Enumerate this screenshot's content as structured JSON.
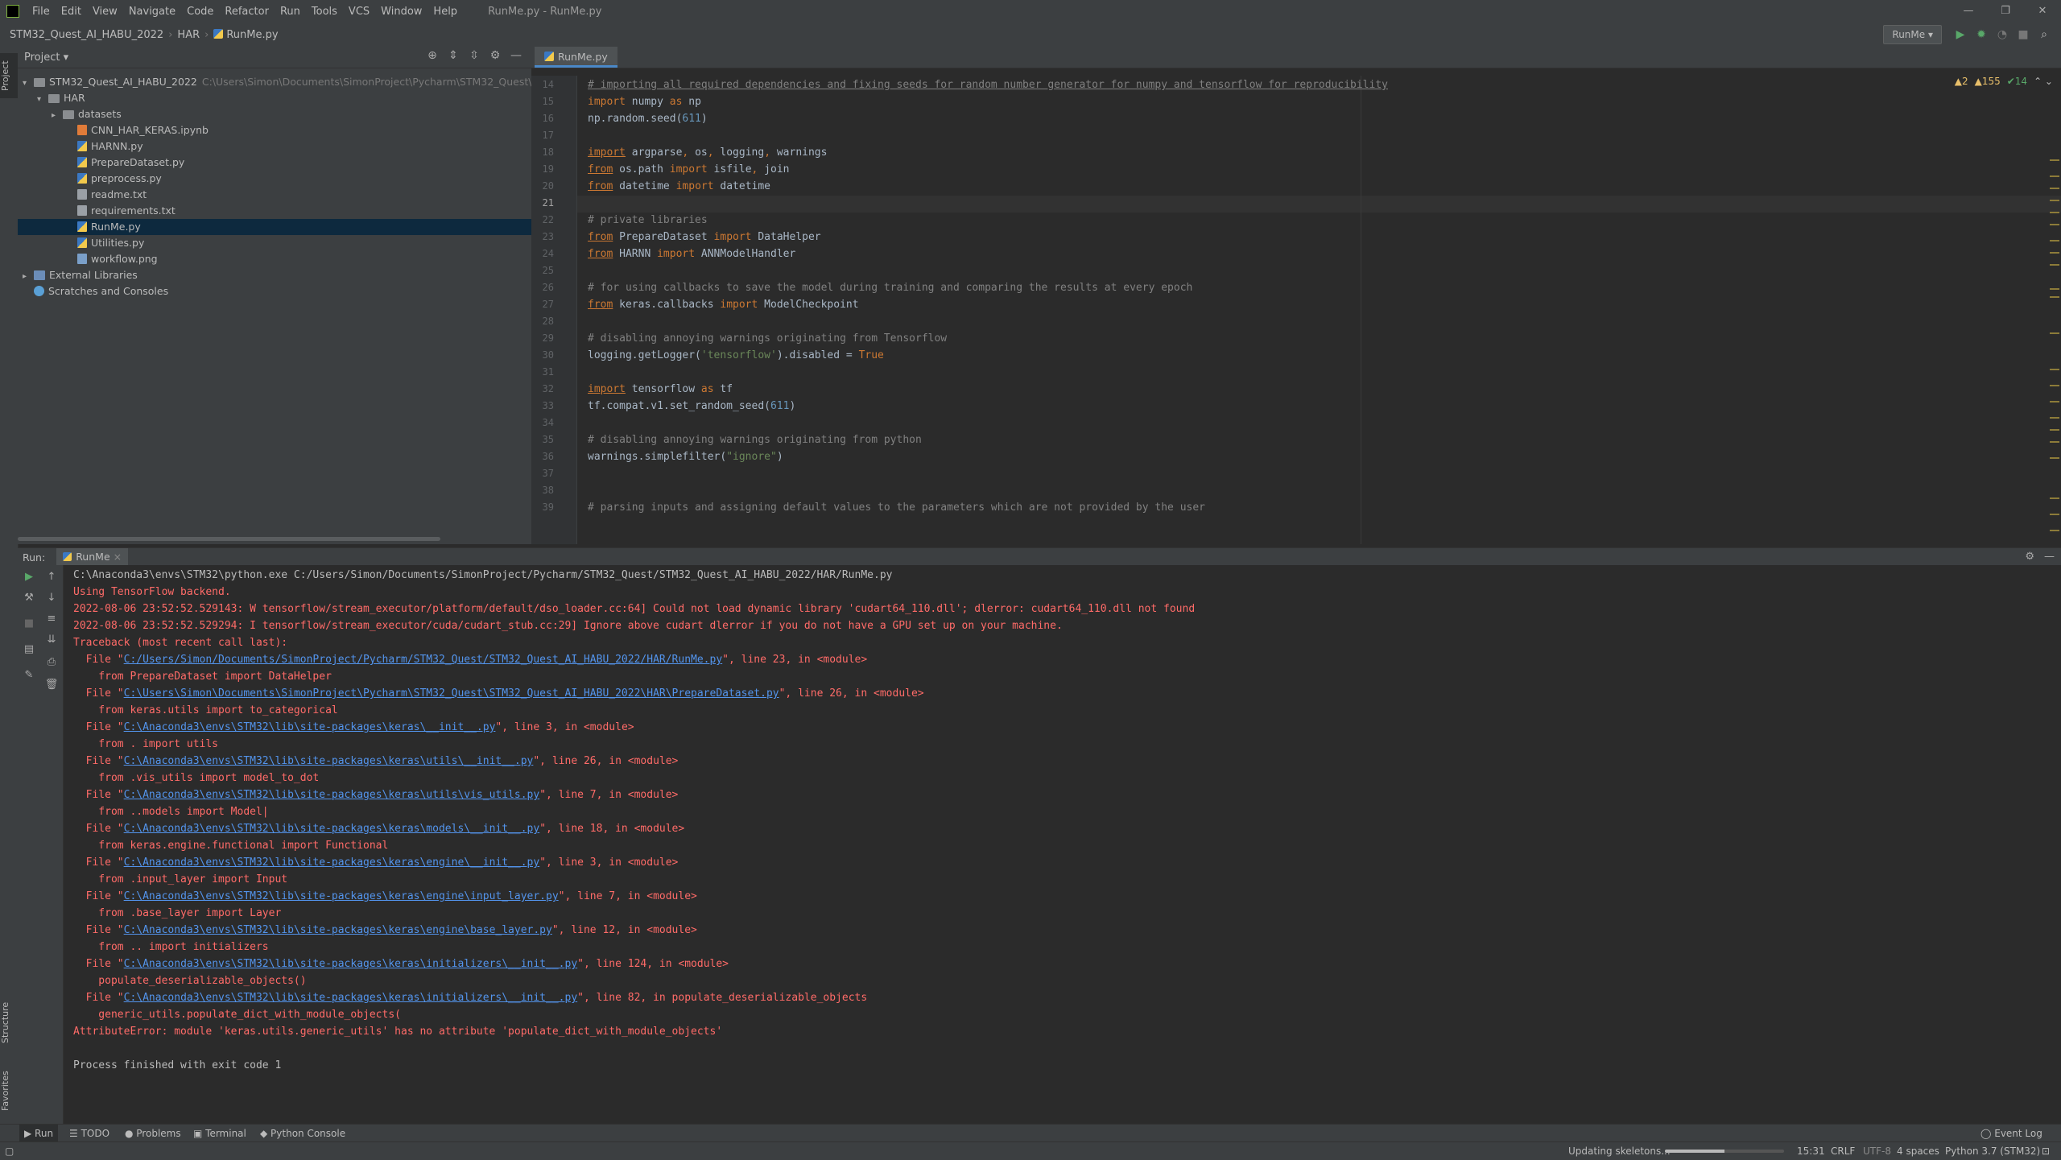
{
  "menubar": {
    "items": [
      "File",
      "Edit",
      "View",
      "Navigate",
      "Code",
      "Refactor",
      "Run",
      "Tools",
      "VCS",
      "Window",
      "Help"
    ],
    "window_title": "RunMe.py - RunMe.py",
    "controls": [
      "—",
      "❐",
      "✕"
    ]
  },
  "navbar": {
    "crumbs": [
      "STM32_Quest_AI_HABU_2022",
      "HAR",
      "RunMe.py"
    ],
    "run_config": "RunMe ▾"
  },
  "left_stripe": {
    "project": "Project",
    "structure": "Structure",
    "favorites": "Favorites"
  },
  "project_panel": {
    "title": "Project ▾",
    "tree": [
      {
        "label": "STM32_Quest_AI_HABU_2022",
        "path": "C:\\Users\\Simon\\Documents\\SimonProject\\Pycharm\\STM32_Quest\\STM3",
        "icon": "folder",
        "arrow": "▾",
        "indent": 0
      },
      {
        "label": "HAR",
        "icon": "folder",
        "arrow": "▾",
        "indent": 1
      },
      {
        "label": "datasets",
        "icon": "folder",
        "arrow": "▸",
        "indent": 2
      },
      {
        "label": "CNN_HAR_KERAS.ipynb",
        "icon": "nb",
        "arrow": "",
        "indent": 3
      },
      {
        "label": "HARNN.py",
        "icon": "py",
        "arrow": "",
        "indent": 3
      },
      {
        "label": "PrepareDataset.py",
        "icon": "py",
        "arrow": "",
        "indent": 3
      },
      {
        "label": "preprocess.py",
        "icon": "py",
        "arrow": "",
        "indent": 3
      },
      {
        "label": "readme.txt",
        "icon": "txt",
        "arrow": "",
        "indent": 3
      },
      {
        "label": "requirements.txt",
        "icon": "txt",
        "arrow": "",
        "indent": 3
      },
      {
        "label": "RunMe.py",
        "icon": "py",
        "arrow": "",
        "indent": 3,
        "selected": true
      },
      {
        "label": "Utilities.py",
        "icon": "py",
        "arrow": "",
        "indent": 3
      },
      {
        "label": "workflow.png",
        "icon": "img",
        "arrow": "",
        "indent": 3
      },
      {
        "label": "External Libraries",
        "icon": "lib",
        "arrow": "▸",
        "indent": 0
      },
      {
        "label": "Scratches and Consoles",
        "icon": "scr",
        "arrow": "",
        "indent": 0
      }
    ]
  },
  "editor": {
    "tab": "RunMe.py",
    "inspections": {
      "warn1": "▲2",
      "warn2": "▲155",
      "ok": "✔14",
      "nav": "⌃ ⌄"
    },
    "current_line": 21,
    "lines": [
      {
        "n": 14,
        "html": "<span class=\"cm ul\"># importing all required dependencies and fixing seeds for random number generator for numpy and tensorflow for reproducibility</span>"
      },
      {
        "n": 15,
        "html": "<span class=\"kw\">import</span> numpy <span class=\"kw\">as</span> np"
      },
      {
        "n": 16,
        "html": "np.random.seed(<span class=\"num\">611</span>)"
      },
      {
        "n": 17,
        "html": ""
      },
      {
        "n": 18,
        "html": "<span class=\"kw ul\">import</span> argparse<span class=\"kw\">,</span> os<span class=\"kw\">,</span> logging<span class=\"kw\">,</span> warnings"
      },
      {
        "n": 19,
        "html": "<span class=\"kw ul\">from</span> os.path <span class=\"kw\">import</span> isfile<span class=\"kw\">,</span> join"
      },
      {
        "n": 20,
        "html": "<span class=\"kw ul\">from</span> datetime <span class=\"kw\">import</span> datetime"
      },
      {
        "n": 21,
        "html": ""
      },
      {
        "n": 22,
        "html": "<span class=\"cm\"># private libraries</span>"
      },
      {
        "n": 23,
        "html": "<span class=\"kw ul\">from</span> PrepareDataset <span class=\"kw\">import</span> DataHelper"
      },
      {
        "n": 24,
        "html": "<span class=\"kw ul\">from</span> HARNN <span class=\"kw\">import</span> ANNModelHandler"
      },
      {
        "n": 25,
        "html": ""
      },
      {
        "n": 26,
        "html": "<span class=\"cm\"># for using callbacks to save the model during training and comparing the results at every epoch</span>"
      },
      {
        "n": 27,
        "html": "<span class=\"kw ul\">from</span> keras.callbacks <span class=\"kw\">import</span> ModelCheckpoint"
      },
      {
        "n": 28,
        "html": ""
      },
      {
        "n": 29,
        "html": "<span class=\"cm\"># disabling annoying warnings originating from Tensorflow</span>"
      },
      {
        "n": 30,
        "html": "logging.getLogger(<span class=\"str\">'tensorflow'</span>).disabled = <span class=\"kw\">True</span>"
      },
      {
        "n": 31,
        "html": ""
      },
      {
        "n": 32,
        "html": "<span class=\"kw ul\">import</span> tensorflow <span class=\"kw\">as</span> tf"
      },
      {
        "n": 33,
        "html": "tf.compat.v1.set_random_seed(<span class=\"num\">611</span>)"
      },
      {
        "n": 34,
        "html": ""
      },
      {
        "n": 35,
        "html": "<span class=\"cm\"># disabling annoying warnings originating from python</span>"
      },
      {
        "n": 36,
        "html": "warnings.simplefilter(<span class=\"str\">\"ignore\"</span>)"
      },
      {
        "n": 37,
        "html": ""
      },
      {
        "n": 38,
        "html": ""
      },
      {
        "n": 39,
        "html": "<span class=\"cm\"># parsing inputs and assigning default values to the parameters which are not provided by the user</span>"
      }
    ]
  },
  "run_panel": {
    "label": "Run:",
    "tab": "RunMe",
    "lines": [
      {
        "c": "cw",
        "html": "C:\\Anaconda3\\envs\\STM32\\python.exe C:/Users/Simon/Documents/SimonProject/Pycharm/STM32_Quest/STM32_Quest_AI_HABU_2022/HAR/RunMe.py"
      },
      {
        "c": "cr",
        "html": "Using TensorFlow backend."
      },
      {
        "c": "cr",
        "html": "2022-08-06 23:52:52.529143: W tensorflow/stream_executor/platform/default/dso_loader.cc:64] Could not load dynamic library 'cudart64_110.dll'; dlerror: cudart64_110.dll not found"
      },
      {
        "c": "cr",
        "html": "2022-08-06 23:52:52.529294: I tensorflow/stream_executor/cuda/cudart_stub.cc:29] Ignore above cudart dlerror if you do not have a GPU set up on your machine."
      },
      {
        "c": "cr",
        "html": "Traceback (most recent call last):"
      },
      {
        "c": "cr",
        "html": "  File \"<span class=\"clink\">C:/Users/Simon/Documents/SimonProject/Pycharm/STM32_Quest/STM32_Quest_AI_HABU_2022/HAR/RunMe.py</span>\", line 23, in &lt;module&gt;"
      },
      {
        "c": "cr",
        "html": "    from PrepareDataset import DataHelper"
      },
      {
        "c": "cr",
        "html": "  File \"<span class=\"clink\">C:\\Users\\Simon\\Documents\\SimonProject\\Pycharm\\STM32_Quest\\STM32_Quest_AI_HABU_2022\\HAR\\PrepareDataset.py</span>\", line 26, in &lt;module&gt;"
      },
      {
        "c": "cr",
        "html": "    from keras.utils import to_categorical"
      },
      {
        "c": "cr",
        "html": "  File \"<span class=\"clink\">C:\\Anaconda3\\envs\\STM32\\lib\\site-packages\\keras\\__init__.py</span>\", line 3, in &lt;module&gt;"
      },
      {
        "c": "cr",
        "html": "    from . import utils"
      },
      {
        "c": "cr",
        "html": "  File \"<span class=\"clink\">C:\\Anaconda3\\envs\\STM32\\lib\\site-packages\\keras\\utils\\__init__.py</span>\", line 26, in &lt;module&gt;"
      },
      {
        "c": "cr",
        "html": "    from .vis_utils import model_to_dot"
      },
      {
        "c": "cr",
        "html": "  File \"<span class=\"clink\">C:\\Anaconda3\\envs\\STM32\\lib\\site-packages\\keras\\utils\\vis_utils.py</span>\", line 7, in &lt;module&gt;"
      },
      {
        "c": "cr",
        "html": "    from ..models import Model|"
      },
      {
        "c": "cr",
        "html": "  File \"<span class=\"clink\">C:\\Anaconda3\\envs\\STM32\\lib\\site-packages\\keras\\models\\__init__.py</span>\", line 18, in &lt;module&gt;"
      },
      {
        "c": "cr",
        "html": "    from keras.engine.functional import Functional"
      },
      {
        "c": "cr",
        "html": "  File \"<span class=\"clink\">C:\\Anaconda3\\envs\\STM32\\lib\\site-packages\\keras\\engine\\__init__.py</span>\", line 3, in &lt;module&gt;"
      },
      {
        "c": "cr",
        "html": "    from .input_layer import Input"
      },
      {
        "c": "cr",
        "html": "  File \"<span class=\"clink\">C:\\Anaconda3\\envs\\STM32\\lib\\site-packages\\keras\\engine\\input_layer.py</span>\", line 7, in &lt;module&gt;"
      },
      {
        "c": "cr",
        "html": "    from .base_layer import Layer"
      },
      {
        "c": "cr",
        "html": "  File \"<span class=\"clink\">C:\\Anaconda3\\envs\\STM32\\lib\\site-packages\\keras\\engine\\base_layer.py</span>\", line 12, in &lt;module&gt;"
      },
      {
        "c": "cr",
        "html": "    from .. import initializers"
      },
      {
        "c": "cr",
        "html": "  File \"<span class=\"clink\">C:\\Anaconda3\\envs\\STM32\\lib\\site-packages\\keras\\initializers\\__init__.py</span>\", line 124, in &lt;module&gt;"
      },
      {
        "c": "cr",
        "html": "    populate_deserializable_objects()"
      },
      {
        "c": "cr",
        "html": "  File \"<span class=\"clink\">C:\\Anaconda3\\envs\\STM32\\lib\\site-packages\\keras\\initializers\\__init__.py</span>\", line 82, in populate_deserializable_objects"
      },
      {
        "c": "cr",
        "html": "    generic_utils.populate_dict_with_module_objects("
      },
      {
        "c": "cr",
        "html": "AttributeError: module 'keras.utils.generic_utils' has no attribute 'populate_dict_with_module_objects'"
      },
      {
        "c": "cw",
        "html": ""
      },
      {
        "c": "cw",
        "html": "Process finished with exit code 1"
      }
    ]
  },
  "bottom_tabs": [
    {
      "label": "▶ Run",
      "name": "run-tab",
      "active": true
    },
    {
      "label": "☰ TODO",
      "name": "todo-tab"
    },
    {
      "label": "● Problems",
      "name": "problems-tab"
    },
    {
      "label": "▣ Terminal",
      "name": "terminal-tab"
    },
    {
      "label": "◆ Python Console",
      "name": "python-console-tab"
    },
    {
      "label": "◯ Event Log",
      "name": "event-log-tab"
    }
  ],
  "status": {
    "task": "Updating skeletons...",
    "progress": 0.5,
    "position": "15:31",
    "line_sep": "CRLF",
    "encoding": "UTF-8",
    "indent": "4 spaces",
    "interpreter": "Python 3.7 (STM32)"
  },
  "colors": {
    "accent": "#4a88c7",
    "error": "#ff6b68",
    "link": "#5394ec",
    "selection": "#0d293e"
  }
}
